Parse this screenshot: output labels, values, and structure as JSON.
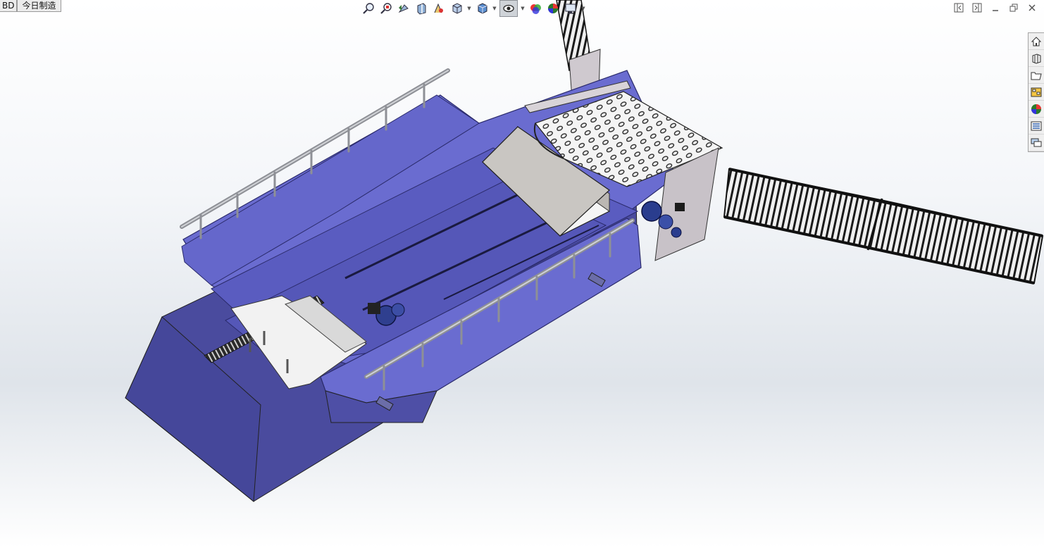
{
  "doc_tabs": [
    {
      "label": "BD"
    },
    {
      "label": "今日制造"
    }
  ],
  "heads_up_toolbar": [
    {
      "icon": "zoom-to-fit-icon"
    },
    {
      "icon": "zoom-to-area-icon"
    },
    {
      "icon": "previous-view-icon"
    },
    {
      "icon": "section-view-icon"
    },
    {
      "icon": "dynamic-annotation-icon"
    },
    {
      "icon": "view-orientation-icon"
    },
    {
      "icon": "display-style-icon"
    },
    {
      "icon": "hide-show-items-icon"
    },
    {
      "icon": "edit-appearance-icon"
    },
    {
      "icon": "apply-scene-icon"
    },
    {
      "icon": "view-settings-icon"
    }
  ],
  "window_controls": [
    {
      "icon": "tile-left-icon"
    },
    {
      "icon": "tile-right-icon"
    },
    {
      "icon": "minimize-icon"
    },
    {
      "icon": "restore-icon"
    },
    {
      "icon": "close-icon"
    }
  ],
  "task_pane": [
    {
      "icon": "home-icon"
    },
    {
      "icon": "design-library-icon"
    },
    {
      "icon": "file-explorer-icon"
    },
    {
      "icon": "view-palette-icon"
    },
    {
      "icon": "appearances-icon"
    },
    {
      "icon": "custom-properties-icon"
    },
    {
      "icon": "forum-icon"
    }
  ],
  "colors": {
    "hull": "#6a6cd0",
    "hull_dark": "#3c3d86",
    "hull_side": "#4e4fa6",
    "rail": "#a8aab0",
    "white_part": "#f2f2f2",
    "gray_part": "#c8c5c2",
    "conveyor": "#1c1c1c"
  }
}
